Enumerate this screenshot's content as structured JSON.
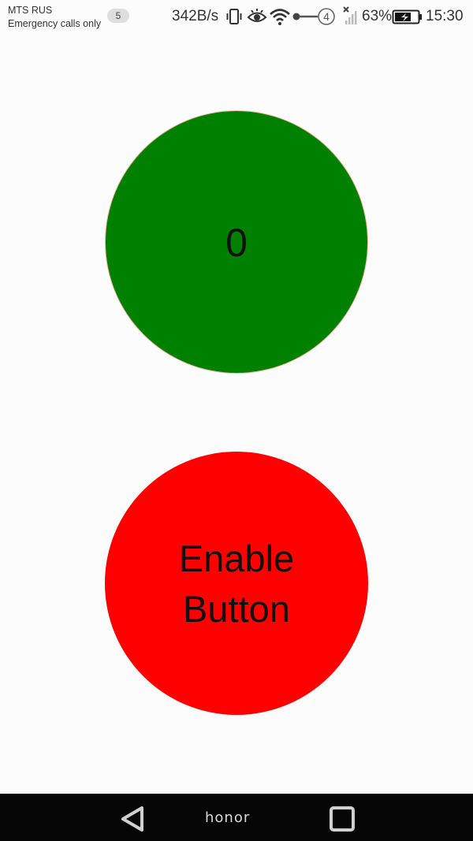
{
  "status_bar": {
    "carrier": "MTS RUS",
    "carrier_sub": "Emergency calls only",
    "notification_count": "5",
    "net_speed": "342B/s",
    "sim_indicator": "4",
    "battery_percent": "63%",
    "clock": "15:30",
    "icons": [
      "vibrate-icon",
      "eye-icon",
      "wifi-icon",
      "key-icon",
      "sim-icon",
      "signal-icon",
      "battery-icon"
    ]
  },
  "main": {
    "counter_value": "0",
    "counter_color": "#008000",
    "button_label": "Enable Button",
    "button_color": "#ff0000"
  },
  "nav_bar": {
    "brand": "honor",
    "icons": [
      "back-icon",
      "recents-icon"
    ]
  }
}
